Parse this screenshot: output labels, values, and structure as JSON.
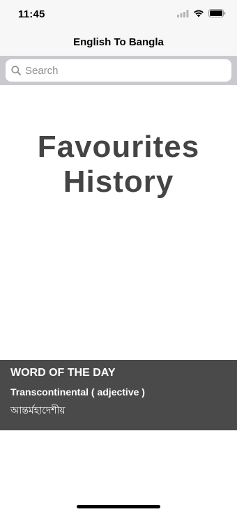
{
  "status_bar": {
    "time": "11:45"
  },
  "nav": {
    "title": "English To Bangla"
  },
  "search": {
    "placeholder": "Search",
    "value": ""
  },
  "links": {
    "favourites": "Favourites",
    "history": "History"
  },
  "word_of_the_day": {
    "heading": "WORD OF THE DAY",
    "word": "Transcontinental ( adjective )",
    "meaning": "আন্তর্মহাদেশীয়"
  },
  "colors": {
    "banner_bg": "#4a4a4a",
    "link_text": "#444444",
    "search_bar_bg": "#c9c9ce"
  }
}
